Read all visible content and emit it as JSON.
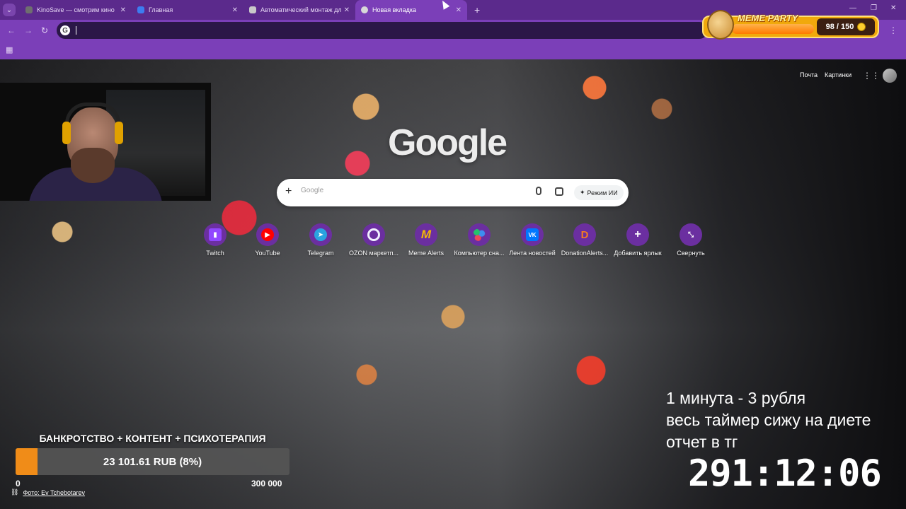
{
  "browser": {
    "tabs": [
      {
        "title": "KinoSave — смотрим кино",
        "active": false,
        "favicon_color": "#6f6f6f"
      },
      {
        "title": "Главная",
        "active": false,
        "favicon_color": "#3d7cf0"
      },
      {
        "title": "Автоматический монтаж для",
        "active": false,
        "favicon_color": "#c9c9c9"
      },
      {
        "title": "Новая вкладка",
        "active": true,
        "favicon_color": "#d8d8d8"
      }
    ],
    "omnibox_value": "",
    "theme_color": "#7b3fb8"
  },
  "meme_party": {
    "title": "MEME PARTY",
    "count": "98 / 150",
    "progress": 0.65
  },
  "ntp": {
    "links": {
      "mail": "Почта",
      "images": "Картинки"
    },
    "logo": "Google",
    "search": {
      "placeholder": "Google",
      "ai_mode": "Режим ИИ"
    },
    "shortcuts": [
      {
        "label": "Twitch",
        "icon": "twitch-icon",
        "color": "#9146ff"
      },
      {
        "label": "YouTube",
        "icon": "youtube-icon",
        "color": "#ff0000"
      },
      {
        "label": "Telegram",
        "icon": "telegram-icon",
        "color": "#2aa3e0"
      },
      {
        "label": "OZON маркетп...",
        "icon": "ozon-icon",
        "color": "#005bff"
      },
      {
        "label": "Meme Alerts",
        "icon": "memealerts-icon",
        "color": "#f2b705"
      },
      {
        "label": "Компьютер сна...",
        "icon": "computer-icon",
        "color": "#25c26b"
      },
      {
        "label": "Лента новостей",
        "icon": "vk-icon",
        "color": "#0077ff"
      },
      {
        "label": "DonationAlerts...",
        "icon": "donationalerts-icon",
        "color": "#f57b20"
      },
      {
        "label": "Добавить ярлык",
        "icon": "plus-icon",
        "color": "#6b2fa0"
      },
      {
        "label": "Свернуть",
        "icon": "collapse-icon",
        "color": "#6b2fa0"
      }
    ],
    "photo_credit": "Фото: Ev Tchebotarev"
  },
  "donation_goal": {
    "title": "БАНКРОТСТВО + КОНТЕНТ + ПСИХОТЕРАПИЯ",
    "amount": "23 101.61 RUB (8%)",
    "progress": 0.08,
    "min": "0",
    "max": "300 000",
    "fill_color": "#f08c18"
  },
  "timer": {
    "lines": [
      "1 минута - 3 рубля",
      "весь таймер сижу на диете",
      "отчет в тг"
    ],
    "clock": "291:12:06"
  }
}
